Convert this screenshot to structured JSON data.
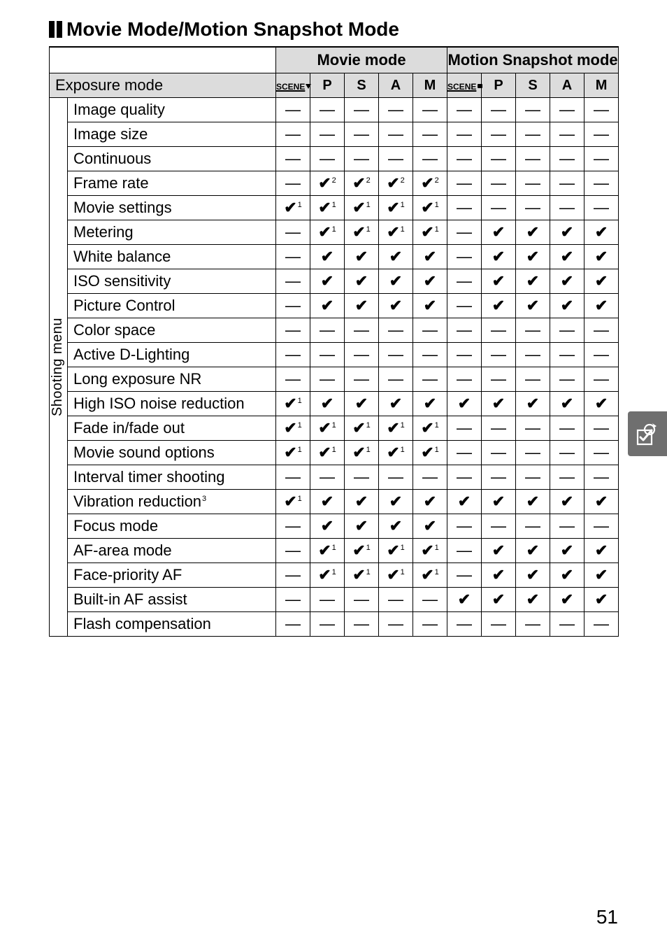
{
  "heading": "Movie Mode/Motion Snapshot Mode",
  "group_headers": {
    "movie": "Movie mode",
    "snapshot": "Motion Snapshot mode"
  },
  "exposure_label": "Exposure mode",
  "mode_labels": {
    "scene": "SCENE",
    "p": "P",
    "s": "S",
    "a": "A",
    "m": "M"
  },
  "category_label": "Shooting menu",
  "page_number": "51",
  "rows": [
    {
      "label": "Image quality",
      "cells": [
        "d",
        "d",
        "d",
        "d",
        "d",
        "d",
        "d",
        "d",
        "d",
        "d"
      ]
    },
    {
      "label": "Image size",
      "cells": [
        "d",
        "d",
        "d",
        "d",
        "d",
        "d",
        "d",
        "d",
        "d",
        "d"
      ]
    },
    {
      "label": "Continuous",
      "cells": [
        "d",
        "d",
        "d",
        "d",
        "d",
        "d",
        "d",
        "d",
        "d",
        "d"
      ]
    },
    {
      "label": "Frame rate",
      "cells": [
        "d",
        "c2",
        "c2",
        "c2",
        "c2",
        "d",
        "d",
        "d",
        "d",
        "d"
      ]
    },
    {
      "label": "Movie settings",
      "cells": [
        "c1",
        "c1",
        "c1",
        "c1",
        "c1",
        "d",
        "d",
        "d",
        "d",
        "d"
      ]
    },
    {
      "label": "Metering",
      "cells": [
        "d",
        "c1",
        "c1",
        "c1",
        "c1",
        "d",
        "c",
        "c",
        "c",
        "c"
      ]
    },
    {
      "label": "White balance",
      "cells": [
        "d",
        "c",
        "c",
        "c",
        "c",
        "d",
        "c",
        "c",
        "c",
        "c"
      ]
    },
    {
      "label": "ISO sensitivity",
      "cells": [
        "d",
        "c",
        "c",
        "c",
        "c",
        "d",
        "c",
        "c",
        "c",
        "c"
      ]
    },
    {
      "label": "Picture Control",
      "cells": [
        "d",
        "c",
        "c",
        "c",
        "c",
        "d",
        "c",
        "c",
        "c",
        "c"
      ]
    },
    {
      "label": "Color space",
      "cells": [
        "d",
        "d",
        "d",
        "d",
        "d",
        "d",
        "d",
        "d",
        "d",
        "d"
      ]
    },
    {
      "label": "Active D-Lighting",
      "cells": [
        "d",
        "d",
        "d",
        "d",
        "d",
        "d",
        "d",
        "d",
        "d",
        "d"
      ]
    },
    {
      "label": "Long exposure NR",
      "cells": [
        "d",
        "d",
        "d",
        "d",
        "d",
        "d",
        "d",
        "d",
        "d",
        "d"
      ]
    },
    {
      "label": "High ISO noise reduction",
      "cells": [
        "c1",
        "c",
        "c",
        "c",
        "c",
        "c",
        "c",
        "c",
        "c",
        "c"
      ]
    },
    {
      "label": "Fade in/fade out",
      "cells": [
        "c1",
        "c1",
        "c1",
        "c1",
        "c1",
        "d",
        "d",
        "d",
        "d",
        "d"
      ]
    },
    {
      "label": "Movie sound options",
      "cells": [
        "c1",
        "c1",
        "c1",
        "c1",
        "c1",
        "d",
        "d",
        "d",
        "d",
        "d"
      ]
    },
    {
      "label": "Interval timer shooting",
      "cells": [
        "d",
        "d",
        "d",
        "d",
        "d",
        "d",
        "d",
        "d",
        "d",
        "d"
      ]
    },
    {
      "label": "Vibration reduction",
      "label_sup": "3",
      "cells": [
        "c1",
        "c",
        "c",
        "c",
        "c",
        "c",
        "c",
        "c",
        "c",
        "c"
      ]
    },
    {
      "label": "Focus mode",
      "cells": [
        "d",
        "c",
        "c",
        "c",
        "c",
        "d",
        "d",
        "d",
        "d",
        "d"
      ]
    },
    {
      "label": "AF-area mode",
      "cells": [
        "d",
        "c1",
        "c1",
        "c1",
        "c1",
        "d",
        "c",
        "c",
        "c",
        "c"
      ]
    },
    {
      "label": "Face-priority AF",
      "cells": [
        "d",
        "c1",
        "c1",
        "c1",
        "c1",
        "d",
        "c",
        "c",
        "c",
        "c"
      ]
    },
    {
      "label": "Built-in AF assist",
      "cells": [
        "d",
        "d",
        "d",
        "d",
        "d",
        "c",
        "c",
        "c",
        "c",
        "c"
      ]
    },
    {
      "label": "Flash compensation",
      "cells": [
        "d",
        "d",
        "d",
        "d",
        "d",
        "d",
        "d",
        "d",
        "d",
        "d"
      ]
    }
  ]
}
